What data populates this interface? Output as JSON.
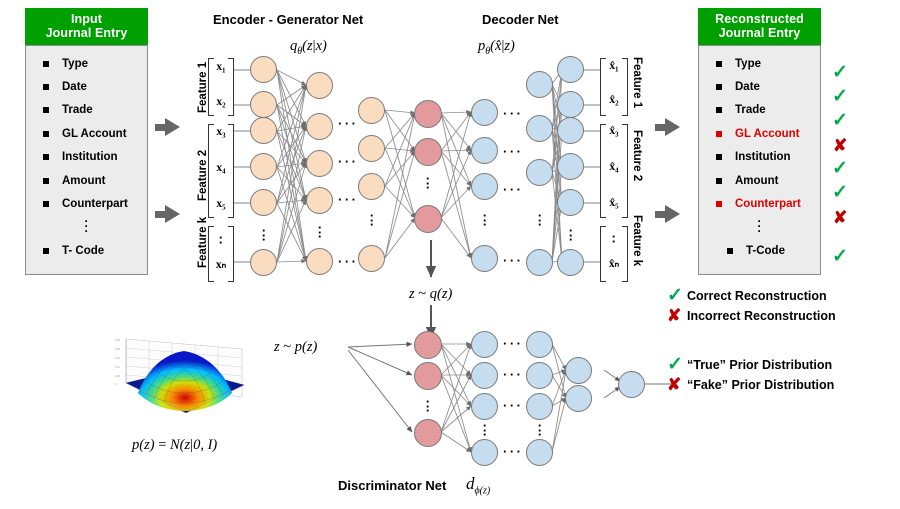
{
  "input_panel": {
    "title_line1": "Input",
    "title_line2": "Journal Entry",
    "items": [
      {
        "label": "Type",
        "error": false
      },
      {
        "label": "Date",
        "error": false
      },
      {
        "label": "Trade",
        "error": false
      },
      {
        "label": "GL Account",
        "error": false
      },
      {
        "label": "Institution",
        "error": false
      },
      {
        "label": "Amount",
        "error": false
      },
      {
        "label": "Counterpart",
        "error": false
      }
    ],
    "ellipsis": "·",
    "last_item": "T- Code"
  },
  "output_panel": {
    "title_line1": "Reconstructed",
    "title_line2": "Journal Entry",
    "items": [
      {
        "label": "Type",
        "error": false,
        "mark": "check"
      },
      {
        "label": "Date",
        "error": false,
        "mark": "check"
      },
      {
        "label": "Trade",
        "error": false,
        "mark": "check"
      },
      {
        "label": "GL Account",
        "error": true,
        "mark": "cross"
      },
      {
        "label": "Institution",
        "error": false,
        "mark": "check"
      },
      {
        "label": "Amount",
        "error": false,
        "mark": "check"
      },
      {
        "label": "Counterpart",
        "error": true,
        "mark": "cross"
      }
    ],
    "last_item": "T-Code",
    "last_mark": "check"
  },
  "sections": {
    "encoder_title": "Encoder - Generator Net",
    "decoder_title": "Decoder Net",
    "discriminator_title": "Discriminator Net"
  },
  "formulas": {
    "encoder": "qθ(z|x)",
    "decoder": "pθ(x̂|z)",
    "sample_q": "z ~ q(z)",
    "sample_p": "z ~ p(z)",
    "prior": "p(z) = N(z|0, I)",
    "discriminator": "dϕ(z)"
  },
  "feature_labels_left": [
    "Feature 1",
    "Feature 2",
    "Feature k"
  ],
  "feature_labels_right": [
    "Feature 1",
    "Feature 2",
    "Feature k"
  ],
  "input_vector": [
    "x₁",
    "x₂",
    "x₃",
    "x₄",
    "x₅",
    "xₙ"
  ],
  "output_vector": [
    "x̂₁",
    "x̂₂",
    "x̂₃",
    "x̂₄",
    "x̂₅",
    "x̂ₙ"
  ],
  "legend": [
    {
      "mark": "check",
      "label": "Correct Reconstruction"
    },
    {
      "mark": "cross",
      "label": "Incorrect Reconstruction"
    },
    {
      "mark": "check",
      "label": "“True” Prior Distribution"
    },
    {
      "mark": "cross",
      "label": "“Fake” Prior Distribution"
    }
  ],
  "colors": {
    "green": "#00a000",
    "red": "#e00000",
    "check_green": "#00a84f",
    "cross_red": "#c00000",
    "node_encoder": "#fadcc0",
    "node_decoder": "#c6dcef",
    "node_latent": "#e39a9d",
    "arrow_gray": "#666666"
  },
  "plot": {
    "type": "surface",
    "description": "3D Gaussian probability density surface",
    "caption": "p(z) = N(z|0, I)"
  },
  "marks": {
    "check": "✓",
    "cross": "✘"
  }
}
